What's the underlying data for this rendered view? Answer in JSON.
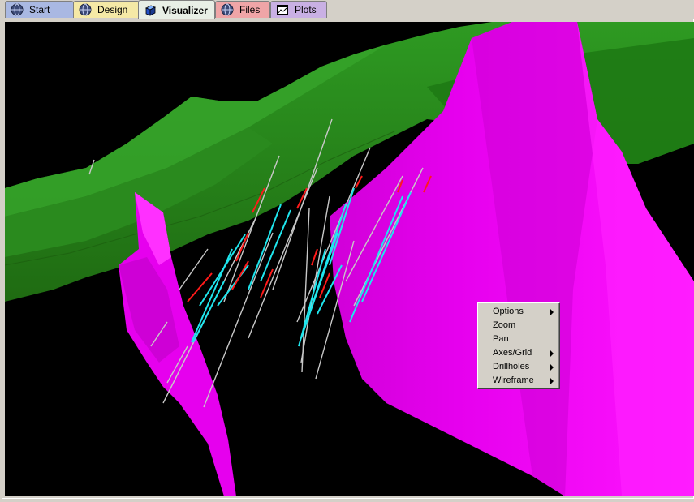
{
  "tabs": [
    {
      "label": "Start",
      "icon": "globe-icon"
    },
    {
      "label": "Design",
      "icon": "globe-icon"
    },
    {
      "label": "Visualizer",
      "icon": "3d-cube-icon",
      "active": true
    },
    {
      "label": "Files",
      "icon": "globe-icon"
    },
    {
      "label": "Plots",
      "icon": "chart-window-icon"
    }
  ],
  "context_menu": {
    "items": [
      {
        "label": "Options",
        "has_submenu": true
      },
      {
        "label": "Zoom",
        "has_submenu": false
      },
      {
        "label": "Pan",
        "has_submenu": false
      },
      {
        "label": "Axes/Grid",
        "has_submenu": true
      },
      {
        "label": "Drillholes",
        "has_submenu": true
      },
      {
        "label": "Wireframe",
        "has_submenu": true
      }
    ]
  },
  "colors": {
    "viewport_background": "#000000",
    "topography_surface": "#2f8f1f",
    "ore_wireframe": "#ff00ff",
    "drillhole_trace": "#c8c8c8",
    "drillhole_interval_high": "#ff1a1a",
    "drillhole_interval_mid": "#1fe6ee"
  }
}
